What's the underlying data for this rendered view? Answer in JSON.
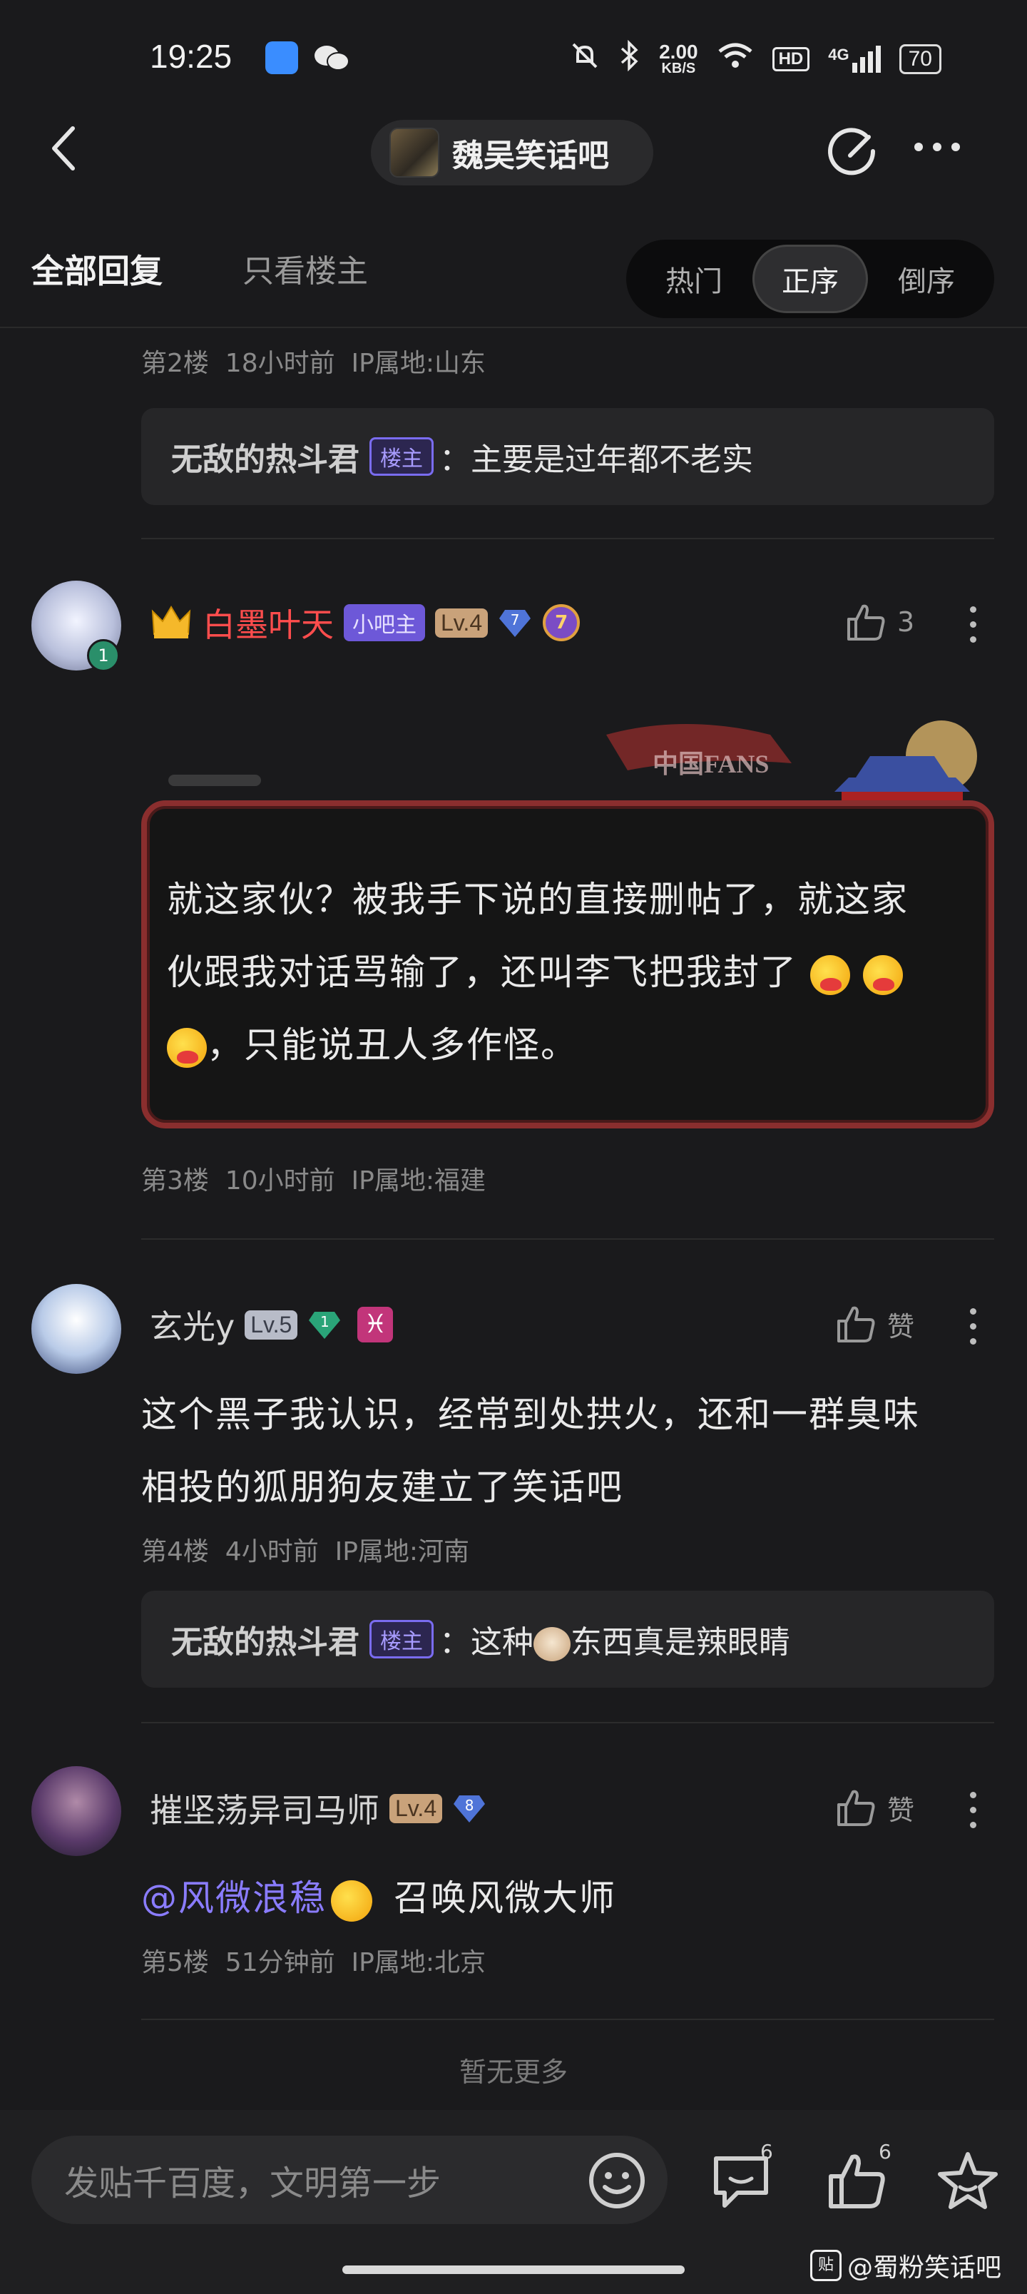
{
  "status_bar": {
    "time": "19:25",
    "speed_top": "2.00",
    "speed_bottom": "KB/S",
    "network": "4G",
    "battery": "70",
    "icons": [
      "blue-app-icon",
      "wechat-icon",
      "mute-icon",
      "bluetooth-icon",
      "wifi-icon",
      "hd-icon",
      "signal-icon"
    ]
  },
  "nav": {
    "forum_name": "魏吴笑话吧"
  },
  "tabs": {
    "all_replies": "全部回复",
    "op_only": "只看楼主"
  },
  "sort": {
    "options": [
      "热门",
      "正序",
      "倒序"
    ],
    "active": "正序"
  },
  "posts": [
    {
      "floor_meta": {
        "floor": "第2楼",
        "time": "18小时前",
        "ip": "IP属地:山东"
      },
      "reply": {
        "author": "无敌的热斗君",
        "badge": "楼主",
        "text": "：主要是过年都不老实"
      }
    },
    {
      "username": "白墨叶天",
      "role_badge": "小吧主",
      "level": "Lv.4",
      "gem": "7",
      "medal": "7",
      "likes": "3",
      "card_watermark": "中国FANS",
      "text_line1": "就这家伙？被我手下说的直接删帖了，就这家",
      "text_line2": "伙跟我对话骂输了，还叫李飞把我封了",
      "text_line3": "，只能说丑人多作怪。",
      "floor_meta": {
        "floor": "第3楼",
        "time": "10小时前",
        "ip": "IP属地:福建"
      }
    },
    {
      "username": "玄光y",
      "level": "Lv.5",
      "gem": "1",
      "zodiac": "♓",
      "likes": "赞",
      "text_line1": "这个黑子我认识，经常到处拱火，还和一群臭味",
      "text_line2": "相投的狐朋狗友建立了笑话吧",
      "floor_meta": {
        "floor": "第4楼",
        "time": "4小时前",
        "ip": "IP属地:河南"
      },
      "reply": {
        "author": "无敌的热斗君",
        "badge": "楼主",
        "text_before": "：这种",
        "text_after": "东西真是辣眼睛"
      }
    },
    {
      "username": "摧坚荡异司马师",
      "level": "Lv.4",
      "gem": "8",
      "likes": "赞",
      "mention": "@风微浪稳",
      "text": "召唤风微大师",
      "floor_meta": {
        "floor": "第5楼",
        "time": "51分钟前",
        "ip": "IP属地:北京"
      }
    }
  ],
  "end_text": "暂无更多",
  "bottom_bar": {
    "input_placeholder": "发贴千百度，文明第一步",
    "comment_count": "6",
    "like_count": "6"
  },
  "watermark": "@蜀粉笑话吧",
  "colors": {
    "background": "#1a1a1c",
    "crown_name": "#ff4d4d",
    "mention": "#8a7cff",
    "op_badge": "#7a6cf0"
  }
}
